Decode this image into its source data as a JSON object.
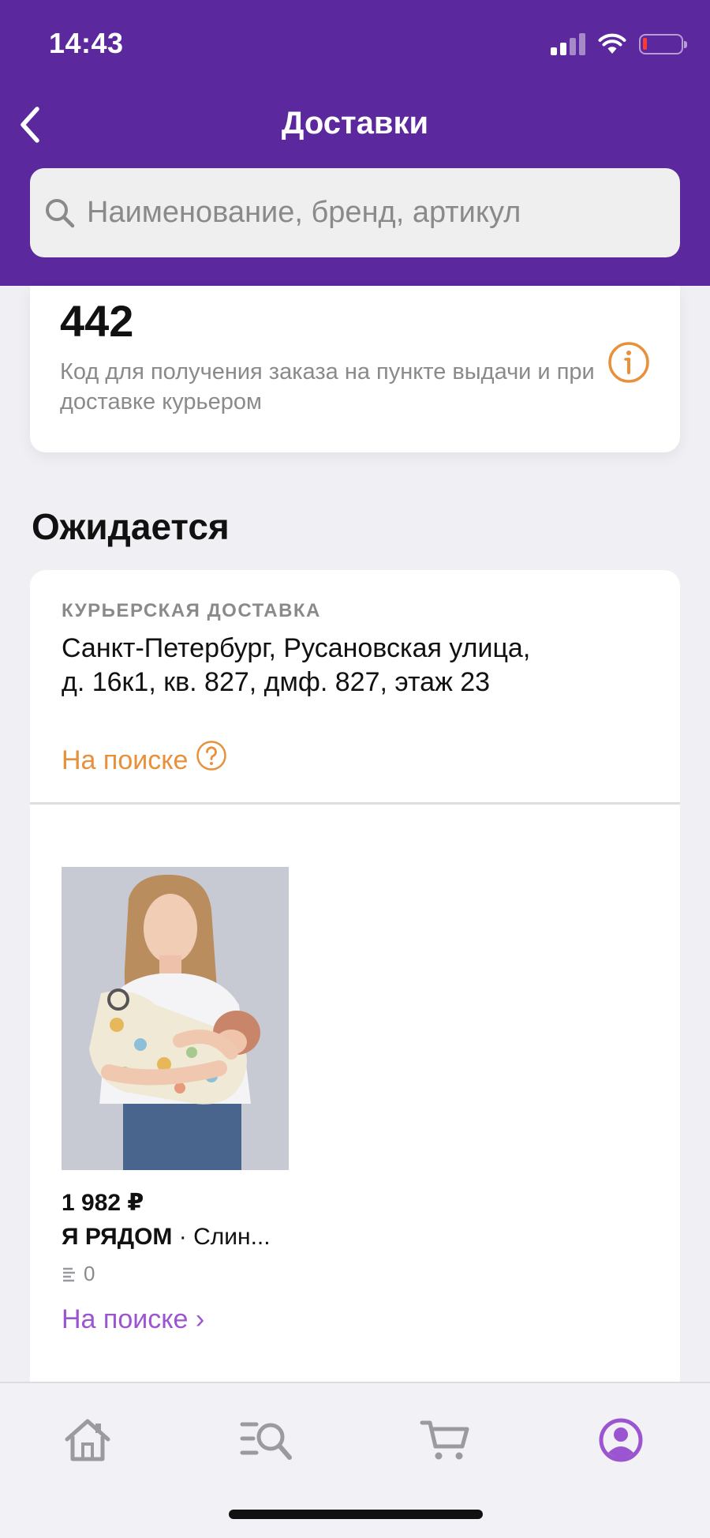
{
  "status_bar": {
    "time": "14:43"
  },
  "nav": {
    "title": "Доставки",
    "back_icon": "chevron-left-icon"
  },
  "search": {
    "placeholder": "Наименование, бренд, артикул",
    "icon": "search-icon"
  },
  "code_card": {
    "code": "442",
    "description": "Код для получения заказа на пункте выдачи и при доставке курьером",
    "info_icon": "info-icon"
  },
  "section": {
    "title": "Ожидается"
  },
  "delivery": {
    "type_label": "КУРЬЕРСКАЯ ДОСТАВКА",
    "address": "Санкт-Петербург, Русановская улица, д. 16к1, кв. 827, дмф. 827, этаж 23",
    "status": "На поиске",
    "item": {
      "price": "1 982 ₽",
      "brand": "Я РЯДОМ",
      "separator": " · ",
      "name": "Слин...",
      "quantity": "0",
      "status_link": "На поиске ›"
    }
  },
  "colors": {
    "header": "#5c289d",
    "accent_orange": "#e8903a",
    "accent_purple": "#9b55d1",
    "active_tab": "#9b55d1",
    "inactive_tab": "#9a9aa0"
  },
  "tabbar": {
    "tabs": [
      {
        "icon": "home-icon",
        "active": false
      },
      {
        "icon": "catalog-search-icon",
        "active": false
      },
      {
        "icon": "cart-icon",
        "active": false
      },
      {
        "icon": "profile-icon",
        "active": true
      }
    ]
  }
}
